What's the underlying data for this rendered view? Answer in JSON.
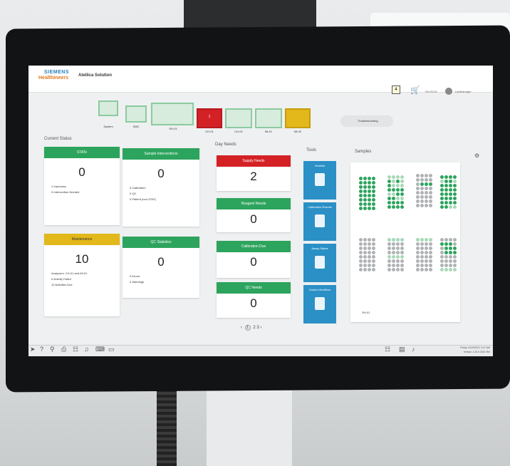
{
  "header": {
    "brand_line1": "SIEMENS",
    "brand_line2": "Healthineers",
    "app_title": "Atellica Solution",
    "calendar_value": "4",
    "host": "SH-SC01",
    "user": "LabManager"
  },
  "system": {
    "modules": [
      {
        "label": "System",
        "status": "normal"
      },
      {
        "label": "SMC",
        "status": "normal"
      },
      {
        "label": "SH-01",
        "status": "normal"
      },
      {
        "label": "CH-01",
        "status": "error",
        "badge": "1"
      },
      {
        "label": "CH-02",
        "status": "normal"
      },
      {
        "label": "IM-01",
        "status": "normal"
      },
      {
        "label": "IM-02",
        "status": "warning"
      }
    ],
    "troubleshooting_label": "Troubleshooting"
  },
  "current_status": {
    "title": "Current Status",
    "stats": {
      "title": "STATs",
      "value": "0",
      "lines": [
        "1  Inprocess",
        "0  Intervention Needed"
      ]
    },
    "sample_interventions": {
      "title": "Sample Interventions",
      "value": "0",
      "lines": [
        "0  Calibration",
        "0  QC",
        "0  Patient (non-STAT)"
      ]
    },
    "maintenance": {
      "title": "Maintenance",
      "value": "10",
      "lines": [
        "Analyzers: CH-01 and IM-01",
        "0  Activity Failed",
        "10  Activities Due"
      ]
    },
    "qc_statistics": {
      "title": "QC Statistics",
      "value": "0",
      "lines": [
        "0  Errors",
        "0  Warnings"
      ]
    }
  },
  "day_needs": {
    "title": "Day Needs",
    "supply": {
      "title": "Supply Needs",
      "value": "2"
    },
    "reagent": {
      "title": "Reagent Needs",
      "value": "0"
    },
    "calibration": {
      "title": "Calibration Due",
      "value": "0"
    },
    "qc": {
      "title": "QC Needs",
      "value": "0"
    }
  },
  "tools": {
    "title": "Tools",
    "items": [
      "Worklist",
      "Calibration Results",
      "Assay Status",
      "Guided Workflow"
    ]
  },
  "samples": {
    "title": "Samples",
    "rack_label": "SH-01"
  },
  "pager": {
    "prev": "‹",
    "pages": [
      "1",
      "2",
      "3"
    ],
    "current": "1",
    "next": "›"
  },
  "footer": {
    "datetime": "Friday 10/29/2021 3:47 AM",
    "version": "Version 1.26.0.0001 Rel"
  },
  "colors": {
    "green": "#2da45d",
    "red": "#d42126",
    "amber": "#e2b81a",
    "blue": "#2a90c6"
  }
}
